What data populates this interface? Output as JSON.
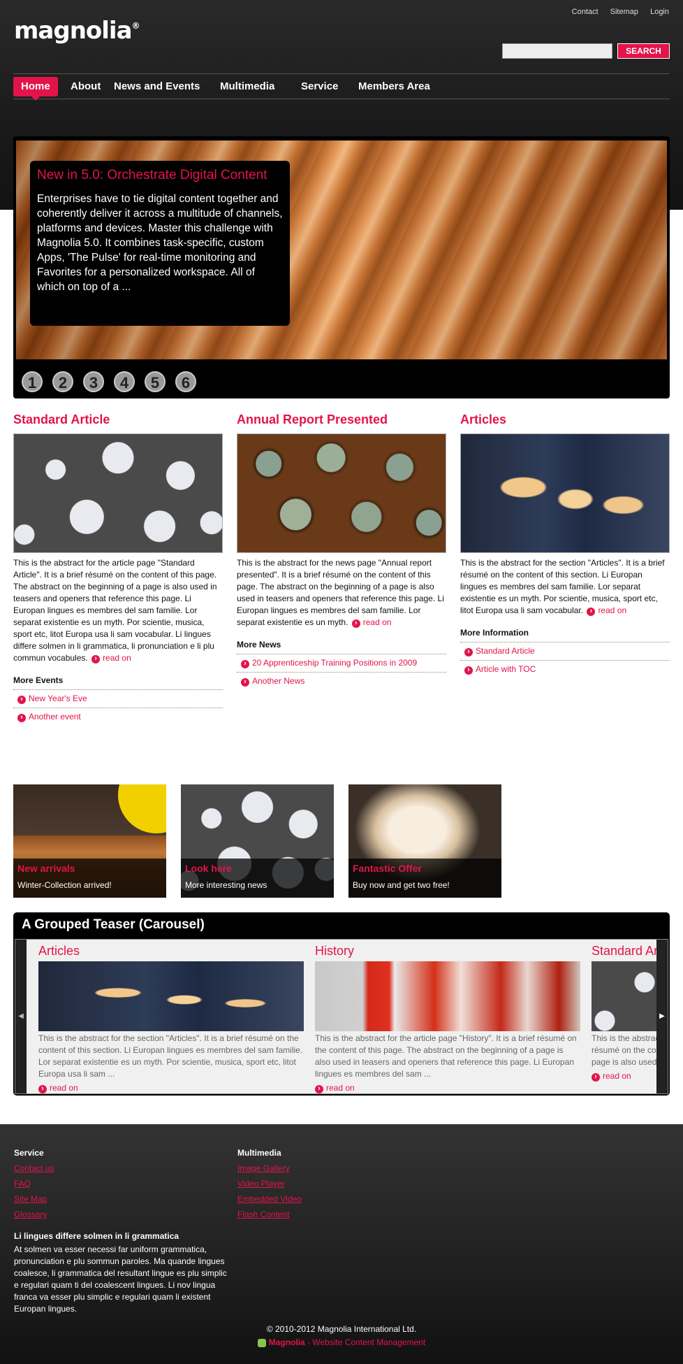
{
  "header": {
    "logo_text": "magnolia",
    "logo_mark": "®",
    "util_links": [
      "Contact",
      "Sitemap",
      "Login"
    ],
    "search_placeholder": "",
    "search_button": "SEARCH"
  },
  "nav": [
    "Home",
    "About",
    "News and Events",
    "Multimedia",
    "Service",
    "Members Area"
  ],
  "hero": {
    "title": "New in 5.0: Orchestrate Digital Content",
    "text": "Enterprises have to tie digital content together and coherently deliver it across a multitude of channels, platforms and devices. Master this challenge with Magnolia 5.0. It combines task-specific, custom Apps, 'The Pulse' for real-time monitoring and Favorites for a personalized workspace. All of which on top of a ...",
    "slides": [
      "1",
      "2",
      "3",
      "4",
      "5",
      "6"
    ]
  },
  "columns": [
    {
      "title": "Standard Article",
      "text": "This is the abstract for the article page \"Standard Article\". It is a brief résumé on the content of this page. The abstract on the beginning of a page is also used in teasers and openers that reference this page. Li Europan lingues es membres del sam familie. Lor separat existentie es un myth. Por scientie, musica, sport etc, litot Europa usa li sam vocabular. Li lingues differe solmen in li grammatica, li pronunciation e li plu commun vocabules.",
      "read_on": "read on",
      "more_title": "More Events",
      "more_items": [
        "New Year's Eve",
        "Another event"
      ]
    },
    {
      "title": "Annual Report Presented",
      "text": "This is the abstract for the news page \"Annual report presented\". It is a brief résumé on the content of this page. The abstract on the beginning of a page is also used in teasers and openers that reference this page. Li Europan lingues es membres del sam familie. Lor separat existentie es un myth.",
      "read_on": "read on",
      "more_title": "More News",
      "more_items": [
        "20 Apprenticeship Training Positions in 2009",
        "Another News"
      ]
    },
    {
      "title": "Articles",
      "text": "This is the abstract for the section \"Articles\". It is a brief résumé on the content of this section. Li Europan lingues es membres del sam familie. Lor separat existentie es un myth. Por scientie, musica, sport etc, litot Europa usa li sam vocabular.",
      "read_on": "read on",
      "more_title": "More Information",
      "more_items": [
        "Standard Article",
        "Article with TOC"
      ]
    }
  ],
  "teasers": [
    {
      "title": "New arrivals",
      "sub": "Winter-Collection arrived!"
    },
    {
      "title": "Look here",
      "sub": "More interesting news"
    },
    {
      "title": "Fantastic Offer",
      "sub": "Buy now and get two free!"
    }
  ],
  "carousel": {
    "title": "A Grouped Teaser (Carousel)",
    "items": [
      {
        "title": "Articles",
        "text": "This is the abstract for the section \"Articles\". It is a brief résumé on the content of this section. Li Europan lingues es membres del sam familie. Lor separat existentie es un myth. Por scientie, musica, sport etc, litot Europa usa li sam ...",
        "read_on": "read on"
      },
      {
        "title": "History",
        "text": "This is the abstract for the article page \"History\". It is a brief résumé on the content of this page. The abstract on the beginning of a page is also used in teasers and openers that reference this page. Li Europan lingues es membres del sam ...",
        "read_on": "read on"
      },
      {
        "title": "Standard Article",
        "text": "This is the abstract for the article page \"Standard Article\". It is a brief résumé on the content of this page. The abstract on the beginning of a page is also used in teasers and openers that reference this page.",
        "read_on": "read on"
      }
    ],
    "prev_icon": "◀",
    "next_icon": "▶"
  },
  "footer": {
    "service_title": "Service",
    "service_links": [
      "Contact us",
      "FAQ",
      "Site Map",
      "Glossary"
    ],
    "multimedia_title": "Multimedia",
    "multimedia_links": [
      "Image Gallery",
      "Video Player",
      "Embedded Video",
      "Flash Content"
    ],
    "blurb_title": "Li lingues differe solmen in li grammatica",
    "blurb_text": "At solmen va esser necessi far uniform grammatica, pronunciation e plu sommun paroles. Ma quande lingues coalesce, li grammatica del resultant lingue es plu simplic e regulari quam ti del coalescent lingues. Li nov lingua franca va esser plu simplic e regulari quam li existent Europan lingues.",
    "copyright": "© 2010-2012 Magnolia International Ltd.",
    "powered_brand": "Magnolia",
    "powered_text": " - Website Content Management"
  },
  "colors": {
    "accent": "#e2144a",
    "dark": "#1a1a1a"
  }
}
